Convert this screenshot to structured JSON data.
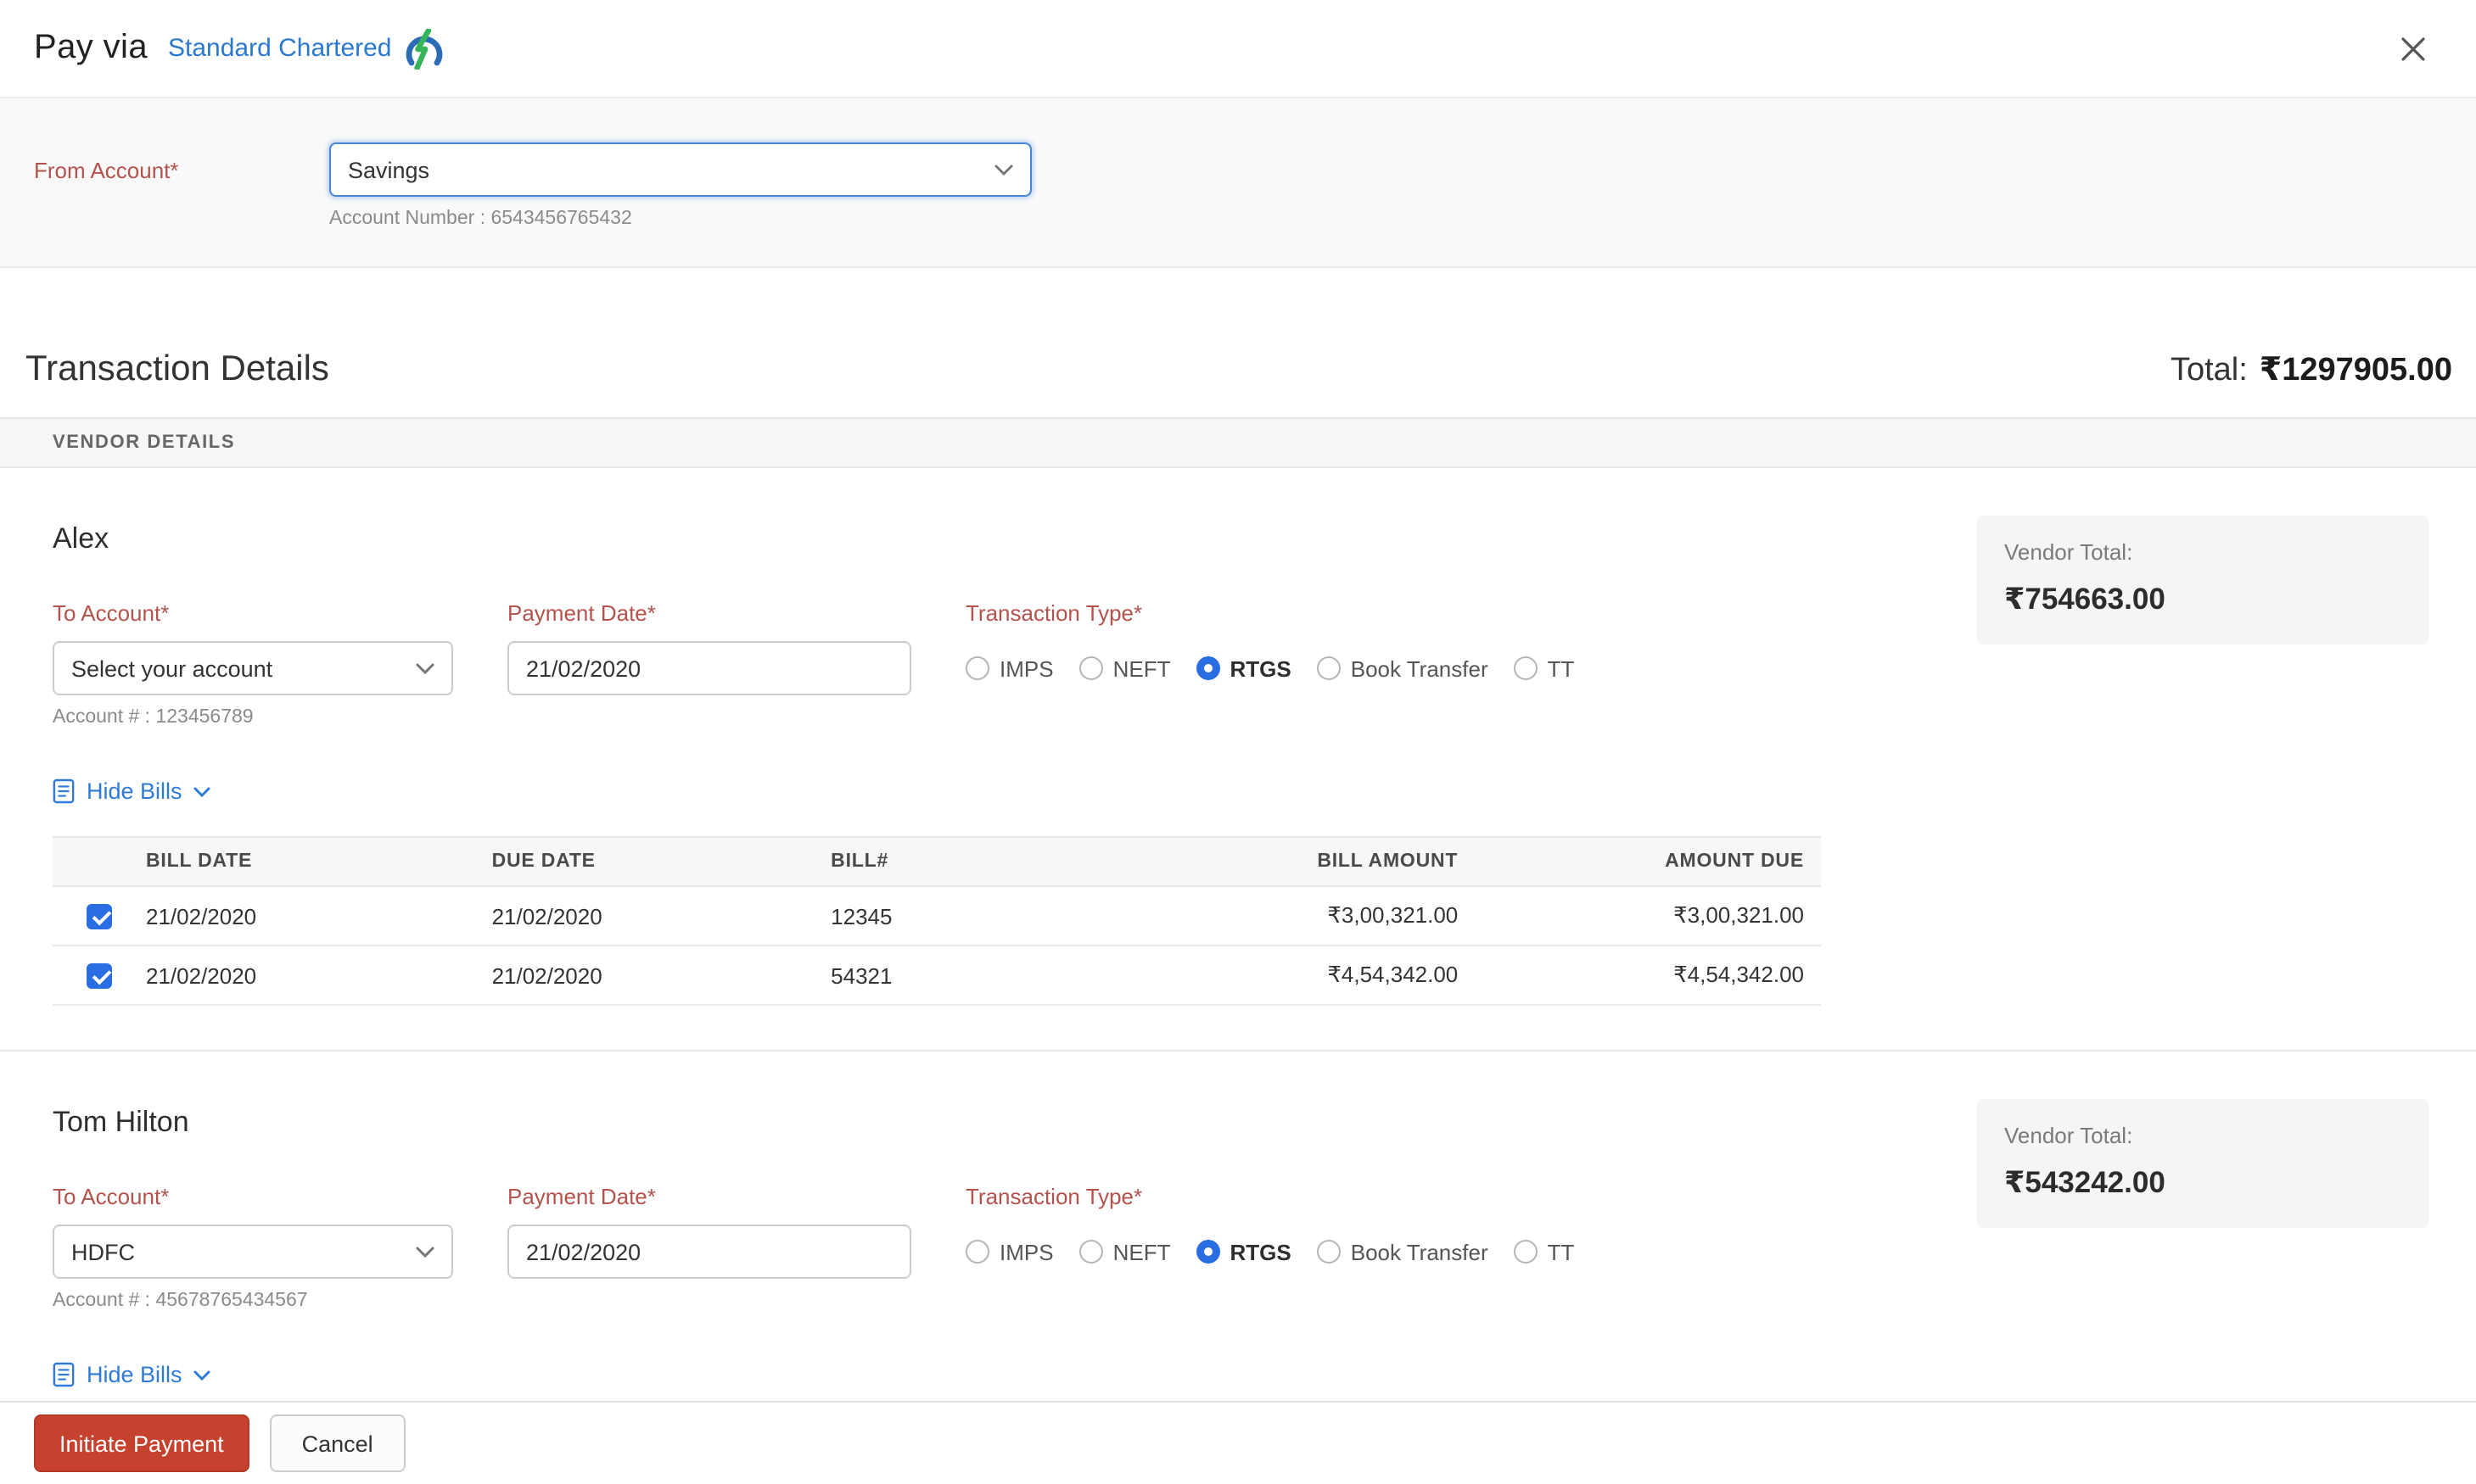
{
  "header": {
    "title": "Pay via",
    "bank": "Standard Chartered"
  },
  "from_account": {
    "label": "From Account*",
    "value": "Savings",
    "hint": "Account Number : 6543456765432"
  },
  "summary": {
    "title": "Transaction Details",
    "total_label": "Total:",
    "total_value": "₹1297905.00"
  },
  "vendor_details_header": "VENDOR DETAILS",
  "colors": {
    "accent_blue": "#2b6de3",
    "link_blue": "#2f7bd9",
    "required_red": "#b4524d",
    "primary_button": "#c7422e"
  },
  "vendors": [
    {
      "name": "Alex",
      "total_label": "Vendor Total:",
      "total_value": "₹754663.00",
      "to_account": {
        "label": "To Account*",
        "value": "Select your account",
        "hint": "Account # : 123456789"
      },
      "payment_date": {
        "label": "Payment Date*",
        "value": "21/02/2020"
      },
      "transaction_type": {
        "label": "Transaction Type*",
        "options": [
          {
            "label": "IMPS",
            "selected": false
          },
          {
            "label": "NEFT",
            "selected": false
          },
          {
            "label": "RTGS",
            "selected": true
          },
          {
            "label": "Book Transfer",
            "selected": false
          },
          {
            "label": "TT",
            "selected": false
          }
        ]
      },
      "bills_toggle": "Hide Bills",
      "table": {
        "headers": [
          "BILL DATE",
          "DUE DATE",
          "BILL#",
          "BILL AMOUNT",
          "AMOUNT DUE"
        ],
        "rows": [
          {
            "checked": true,
            "cells": [
              "21/02/2020",
              "21/02/2020",
              "12345",
              "₹3,00,321.00",
              "₹3,00,321.00"
            ]
          },
          {
            "checked": true,
            "cells": [
              "21/02/2020",
              "21/02/2020",
              "54321",
              "₹4,54,342.00",
              "₹4,54,342.00"
            ]
          }
        ]
      }
    },
    {
      "name": "Tom Hilton",
      "total_label": "Vendor Total:",
      "total_value": "₹543242.00",
      "to_account": {
        "label": "To Account*",
        "value": "HDFC",
        "hint": "Account # : 45678765434567"
      },
      "payment_date": {
        "label": "Payment Date*",
        "value": "21/02/2020"
      },
      "transaction_type": {
        "label": "Transaction Type*",
        "options": [
          {
            "label": "IMPS",
            "selected": false
          },
          {
            "label": "NEFT",
            "selected": false
          },
          {
            "label": "RTGS",
            "selected": true
          },
          {
            "label": "Book Transfer",
            "selected": false
          },
          {
            "label": "TT",
            "selected": false
          }
        ]
      },
      "bills_toggle": "Hide Bills"
    }
  ],
  "footer": {
    "initiate": "Initiate Payment",
    "cancel": "Cancel"
  }
}
